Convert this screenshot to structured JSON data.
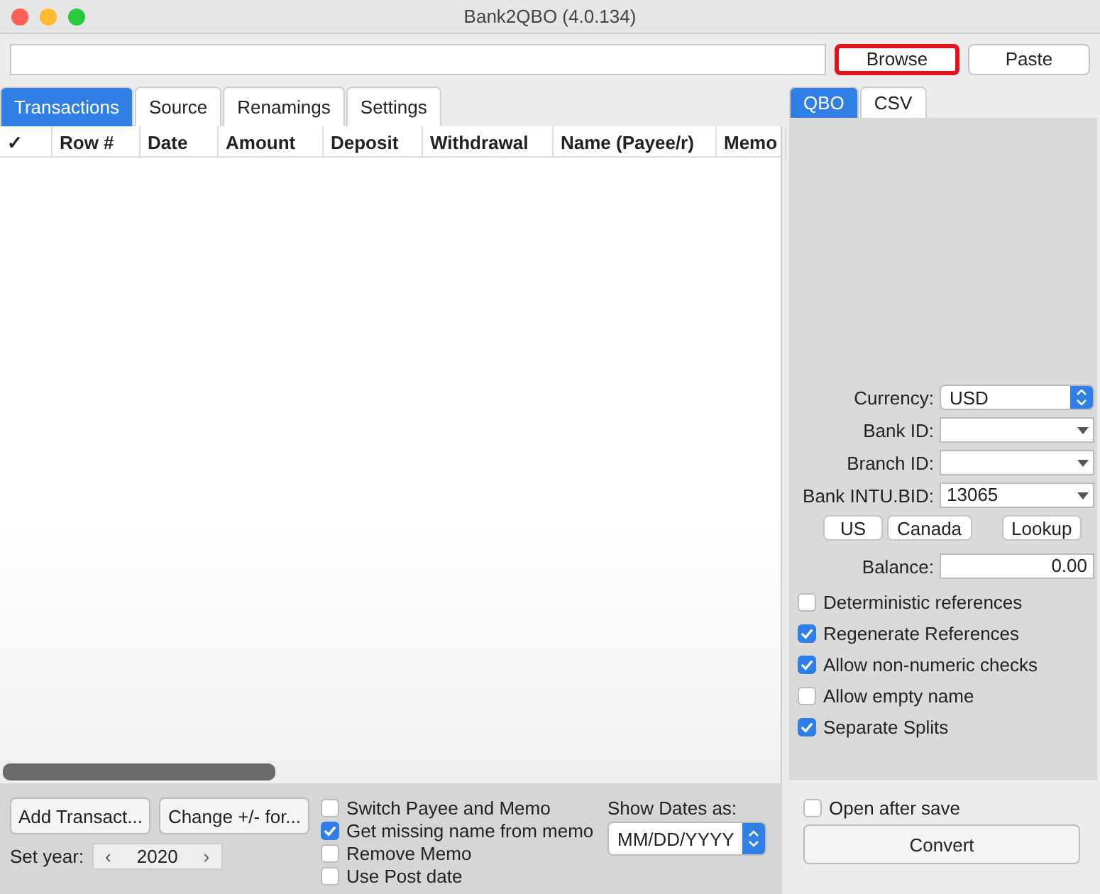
{
  "window": {
    "title": "Bank2QBO (4.0.134)"
  },
  "file_buttons": [
    {
      "label": "Browse",
      "highlighted": true
    },
    {
      "label": "Paste",
      "highlighted": false
    }
  ],
  "tabs": [
    {
      "label": "Transactions",
      "selected": true
    },
    {
      "label": "Source",
      "selected": false
    },
    {
      "label": "Renamings",
      "selected": false
    },
    {
      "label": "Settings",
      "selected": false
    }
  ],
  "table": {
    "columns": [
      "✓",
      "Row #",
      "Date",
      "Amount",
      "Deposit",
      "Withdrawal",
      "Name (Payee/r)",
      "Memo"
    ]
  },
  "bottom": {
    "buttons": [
      "Add Transact...",
      "Change +/- for..."
    ],
    "year_label": "Set year:",
    "year_prev": "‹",
    "year": "2020",
    "year_next": "›",
    "options": [
      {
        "label": "Switch Payee and Memo",
        "checked": false
      },
      {
        "label": "Get missing name from memo",
        "checked": true
      },
      {
        "label": "Remove Memo",
        "checked": false
      },
      {
        "label": "Use Post date",
        "checked": false
      }
    ],
    "dates_label": "Show Dates as:",
    "dates_value": "MM/DD/YYYY"
  },
  "right_tabs": [
    {
      "label": "QBO",
      "selected": true
    },
    {
      "label": "CSV",
      "selected": false
    }
  ],
  "form": {
    "fields": [
      {
        "kind": "select",
        "label": "Currency:",
        "value": "USD"
      },
      {
        "kind": "combo",
        "label": "Bank ID:"
      },
      {
        "kind": "combo",
        "label": "Branch ID:"
      },
      {
        "kind": "combo",
        "label": "Bank INTU.BID:",
        "value": "13065"
      }
    ],
    "buttons": [
      "US",
      "Canada",
      "Lookup"
    ],
    "balance_label": "Balance:",
    "balance": "0.00",
    "options": [
      {
        "label": "Deterministic references",
        "checked": false
      },
      {
        "label": "Regenerate References",
        "checked": true
      },
      {
        "label": "Allow non-numeric checks",
        "checked": true
      },
      {
        "label": "Allow empty name",
        "checked": false
      },
      {
        "label": "Separate Splits",
        "checked": true
      }
    ]
  },
  "open_after_save": {
    "label": "Open after save",
    "checked": false
  },
  "convert": "Convert"
}
